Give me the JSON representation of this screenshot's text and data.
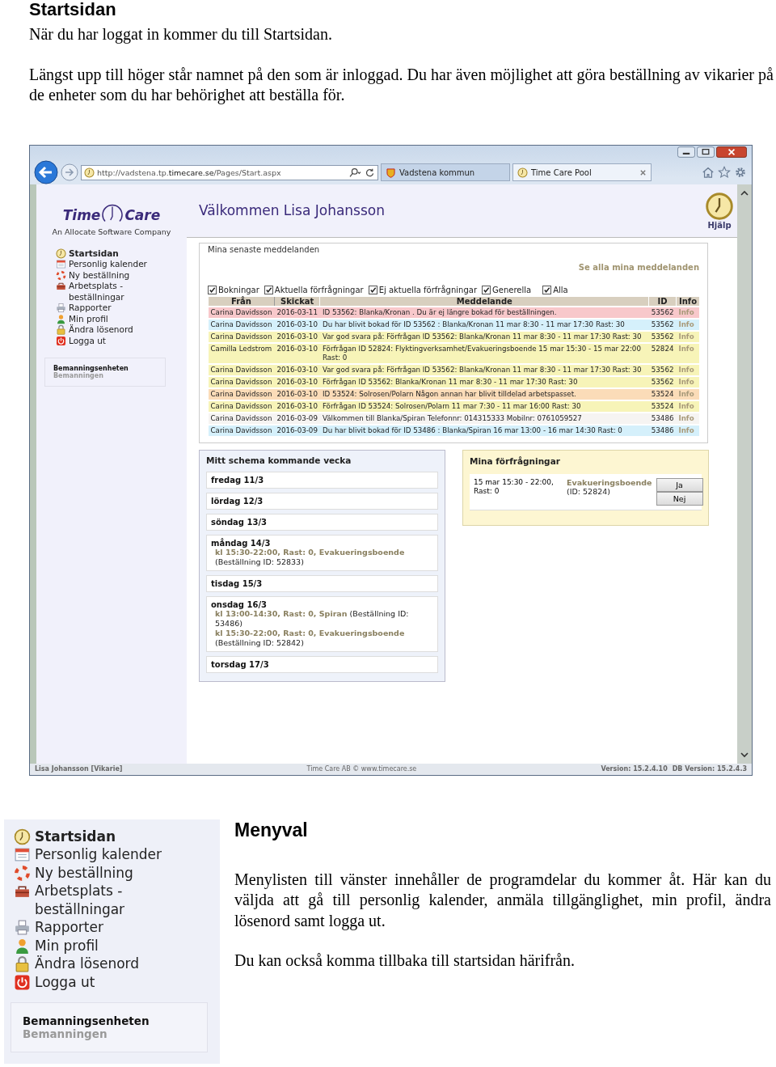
{
  "document": {
    "heading": "Startsidan",
    "paragraphs": [
      "När du har loggat in kommer du till Startsidan.",
      "Längst upp till höger står namnet på den som är inloggad. Du har även möjlighet att göra beställning av vikarier på de enheter som du har behörighet att beställa för."
    ]
  },
  "browser": {
    "url": "http://vadstena.tp.**timecare.se**/Pages/Start.aspx",
    "tabs": [
      {
        "title": "Vadstena kommun",
        "selected": false,
        "kind": "shield"
      },
      {
        "title": "Time Care Pool",
        "selected": true,
        "kind": "clock"
      }
    ]
  },
  "app": {
    "logo": {
      "word_1": "Time",
      "word_2": "Care",
      "tagline": "An Allocate Software Company"
    },
    "welcome": "Välkommen Lisa Johansson",
    "help": "Hjälp",
    "menu": [
      {
        "label": "Startsidan",
        "kind": "clock",
        "selected": true
      },
      {
        "label": "Personlig kalender",
        "kind": "calendar",
        "selected": false
      },
      {
        "label": "Ny beställning",
        "kind": "lifebuoy",
        "selected": false
      },
      {
        "label": "Arbetsplats - beställningar",
        "kind": "toolbox",
        "selected": false
      },
      {
        "label": "Rapporter",
        "kind": "printer",
        "selected": false
      },
      {
        "label": "Min profil",
        "kind": "person",
        "selected": false
      },
      {
        "label": "Ändra lösenord",
        "kind": "lock",
        "selected": false
      },
      {
        "label": "Logga ut",
        "kind": "power",
        "selected": false
      }
    ],
    "unit": {
      "name": "Bemanningsenheten",
      "sub": "Bemanningen"
    },
    "messages": {
      "title": "Mina senaste meddelanden",
      "link": "Se alla mina meddelanden",
      "filters": [
        {
          "label": "Bokningar",
          "checked": true
        },
        {
          "label": "Aktuella förfrågningar",
          "checked": true
        },
        {
          "label": "Ej aktuella förfrågningar",
          "checked": true
        },
        {
          "label": "Generella",
          "checked": true
        },
        {
          "label": "Alla",
          "checked": true
        }
      ],
      "columns": [
        "Från",
        "Skickat",
        "Meddelande",
        "ID",
        "Info"
      ],
      "rows": [
        {
          "from": "Carina Davidsson",
          "sent": "2016-03-11",
          "message": "ID 53562: Blanka/Kronan . Du är ej längre bokad för beställningen.",
          "id": "53562",
          "info": "Info",
          "color": "#f8c8cb"
        },
        {
          "from": "Carina Davidsson",
          "sent": "2016-03-10",
          "message": "Du har blivit bokad för ID 53562 : Blanka/Kronan 11 mar 8:30 - 11 mar 17:30 Rast: 30",
          "id": "53562",
          "info": "Info",
          "color": "#d5f0fb"
        },
        {
          "from": "Carina Davidsson",
          "sent": "2016-03-10",
          "message": "Var god svara på: Förfrågan ID 53562: Blanka/Kronan 11 mar 8:30 - 11 mar 17:30 Rast: 30",
          "id": "53562",
          "info": "Info",
          "color": "#f7f4b8"
        },
        {
          "from": "Camilla Ledstrom",
          "sent": "2016-03-10",
          "message": "Förfrågan ID 52824: Flyktingverksamhet/Evakueringsboende 15 mar 15:30 - 15 mar 22:00 Rast: 0",
          "id": "52824",
          "info": "Info",
          "color": "#f7f4b8"
        },
        {
          "from": "Carina Davidsson",
          "sent": "2016-03-10",
          "message": "Var god svara på: Förfrågan ID 53562: Blanka/Kronan 11 mar 8:30 - 11 mar 17:30 Rast: 30",
          "id": "53562",
          "info": "Info",
          "color": "#f7f4b8"
        },
        {
          "from": "Carina Davidsson",
          "sent": "2016-03-10",
          "message": "Förfrågan ID 53562: Blanka/Kronan 11 mar 8:30 - 11 mar 17:30 Rast: 30",
          "id": "53562",
          "info": "Info",
          "color": "#f7f4b8"
        },
        {
          "from": "Carina Davidsson",
          "sent": "2016-03-10",
          "message": "ID 53524: Solrosen/Polarn Någon annan har blivit tilldelad arbetspasset.",
          "id": "53524",
          "info": "Info",
          "color": "#fbdcb8"
        },
        {
          "from": "Carina Davidsson",
          "sent": "2016-03-10",
          "message": "Förfrågan ID 53524: Solrosen/Polarn 11 mar 7:30 - 11 mar 16:00 Rast: 30",
          "id": "53524",
          "info": "Info",
          "color": "#f7f4b8"
        },
        {
          "from": "Carina Davidsson",
          "sent": "2016-03-09",
          "message": "Välkommen till Blanka/Spiran Telefonnr: 014315333 Mobilnr: 0761059527",
          "id": "53486",
          "info": "Info",
          "color": "#f6f4f2"
        },
        {
          "from": "Carina Davidsson",
          "sent": "2016-03-09",
          "message": "Du har blivit bokad för ID 53486 : Blanka/Spiran 16 mar 13:00 - 16 mar 14:30 Rast: 0",
          "id": "53486",
          "info": "Info",
          "color": "#d5f0fb"
        }
      ]
    },
    "schedule": {
      "title": "Mitt schema kommande vecka",
      "days": [
        {
          "day": "fredag 11/3"
        },
        {
          "day": "lördag 12/3"
        },
        {
          "day": "söndag 13/3"
        },
        {
          "day": "måndag 14/3",
          "entries": [
            "**kl 15:30-22:00, Rast: 0, Evakueringsboende** (Beställning ID: 52833)"
          ]
        },
        {
          "day": "tisdag 15/3"
        },
        {
          "day": "onsdag 16/3",
          "entries": [
            "**kl 13:00-14:30, Rast: 0, Spiran** (Beställning ID: 53486)",
            "**kl 15:30-22:00, Rast: 0, Evakueringsboende** (Beställning ID: 52842)"
          ]
        },
        {
          "day": "torsdag 17/3"
        }
      ]
    },
    "requests": {
      "title": "Mina förfrågningar",
      "items": [
        {
          "time": "15 mar 15:30 - 22:00, Rast: 0",
          "place": "**Evakueringsboende** (ID: 52824)",
          "buttons": [
            "Ja",
            "Nej"
          ]
        }
      ]
    },
    "status_bar": {
      "user": "Lisa Johansson [Vikarie]",
      "company": "Time Care AB © www.timecare.se",
      "version": "Version: 15.2.4.10",
      "db_version": "DB Version: 15.2.4.3"
    }
  },
  "menu_section": {
    "menu": [
      {
        "label": "Startsidan",
        "kind": "clock",
        "selected": true
      },
      {
        "label": "Personlig kalender",
        "kind": "calendar",
        "selected": false
      },
      {
        "label": "Ny beställning",
        "kind": "lifebuoy",
        "selected": false
      },
      {
        "label": "Arbetsplats - beställningar",
        "kind": "toolbox",
        "selected": false
      },
      {
        "label": "Rapporter",
        "kind": "printer",
        "selected": false
      },
      {
        "label": "Min profil",
        "kind": "person",
        "selected": false
      },
      {
        "label": "Ändra lösenord",
        "kind": "lock",
        "selected": false
      },
      {
        "label": "Logga ut",
        "kind": "power",
        "selected": false
      }
    ],
    "unit": {
      "name": "Bemanningsenheten",
      "sub": "Bemanningen"
    },
    "heading": "Menyval",
    "paragraphs": [
      "Menylisten till vänster innehåller de programdelar du kommer åt. Här kan du väljda att gå till personlig kalender, anmäla tillgänglighet, min profil, ändra lösenord samt logga ut.",
      "Du kan också komma tillbaka till startsidan härifrån."
    ]
  }
}
